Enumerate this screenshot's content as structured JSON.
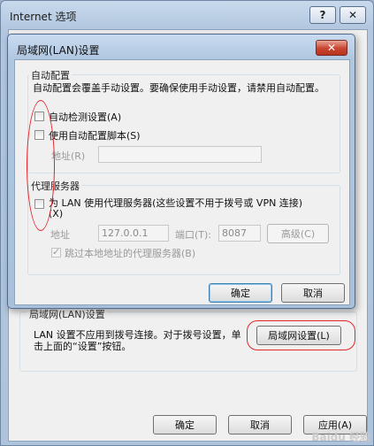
{
  "outer_window": {
    "title": "Internet 选项",
    "help_glyph": "?",
    "close_glyph": "✕",
    "lan_group_label": "局域网(LAN)设置",
    "lan_desc": "LAN 设置不应用到拨号连接。对于拨号设置，单击上面的“设置”按钮。",
    "lan_settings_button": "局域网设置(L)",
    "ok_button": "确定",
    "cancel_button": "取消",
    "apply_button": "应用(A)"
  },
  "dialog": {
    "title": "局域网(LAN)设置",
    "close_glyph": "✕",
    "auto_config": {
      "group_label": "自动配置",
      "desc": "自动配置会覆盖手动设置。要确保使用手动设置，请禁用自动配置。",
      "auto_detect_label": "自动检测设置(A)",
      "use_script_label": "使用自动配置脚本(S)",
      "address_label": "地址(R)",
      "address_value": ""
    },
    "proxy": {
      "group_label": "代理服务器",
      "use_proxy_label_line1": "为 LAN 使用代理服务器(这些设置不用于拨号或 VPN 连接)",
      "use_proxy_label_line2": "(X)",
      "address_label": "地址",
      "address_value": "127.0.0.1",
      "port_label": "端口(T):",
      "port_value": "8087",
      "advanced_button": "高级(C)",
      "bypass_local_label": "跳过本地地址的代理服务器(B)",
      "bypass_local_checked": true
    },
    "ok_button": "确定",
    "cancel_button": "取消"
  },
  "watermark": "Baidu 经验",
  "colors": {
    "annotation_red": "#e0262b",
    "title_bar": "#b3c8e0",
    "dialog_face": "#f0f0f0"
  }
}
